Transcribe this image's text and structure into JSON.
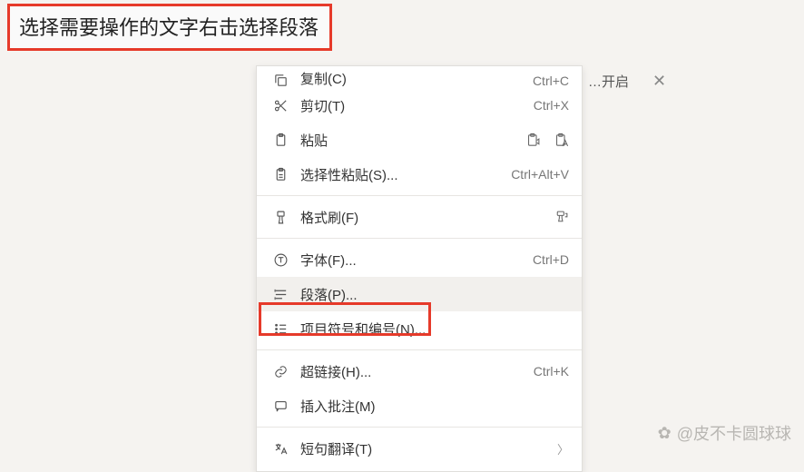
{
  "instruction": "选择需要操作的文字右击选择段落",
  "top_bar": {
    "truncated_label": "…开启",
    "close": "✕"
  },
  "menu": {
    "items": [
      {
        "key": "copy",
        "label": "复制(C)",
        "shortcut": "Ctrl+C"
      },
      {
        "key": "cut",
        "label": "剪切(T)",
        "shortcut": "Ctrl+X"
      },
      {
        "key": "paste",
        "label": "粘贴",
        "shortcut": ""
      },
      {
        "key": "paste_special",
        "label": "选择性粘贴(S)...",
        "shortcut": "Ctrl+Alt+V"
      },
      {
        "key": "format_painter",
        "label": "格式刷(F)",
        "shortcut": ""
      },
      {
        "key": "font",
        "label": "字体(F)...",
        "shortcut": "Ctrl+D"
      },
      {
        "key": "paragraph",
        "label": "段落(P)...",
        "shortcut": ""
      },
      {
        "key": "bullets",
        "label": "项目符号和编号(N)...",
        "shortcut": ""
      },
      {
        "key": "hyperlink",
        "label": "超链接(H)...",
        "shortcut": "Ctrl+K"
      },
      {
        "key": "comment",
        "label": "插入批注(M)",
        "shortcut": ""
      },
      {
        "key": "translate",
        "label": "短句翻译(T)",
        "shortcut": ""
      }
    ]
  },
  "watermark": {
    "icon": "✿",
    "text": "@皮不卡圆球球"
  }
}
